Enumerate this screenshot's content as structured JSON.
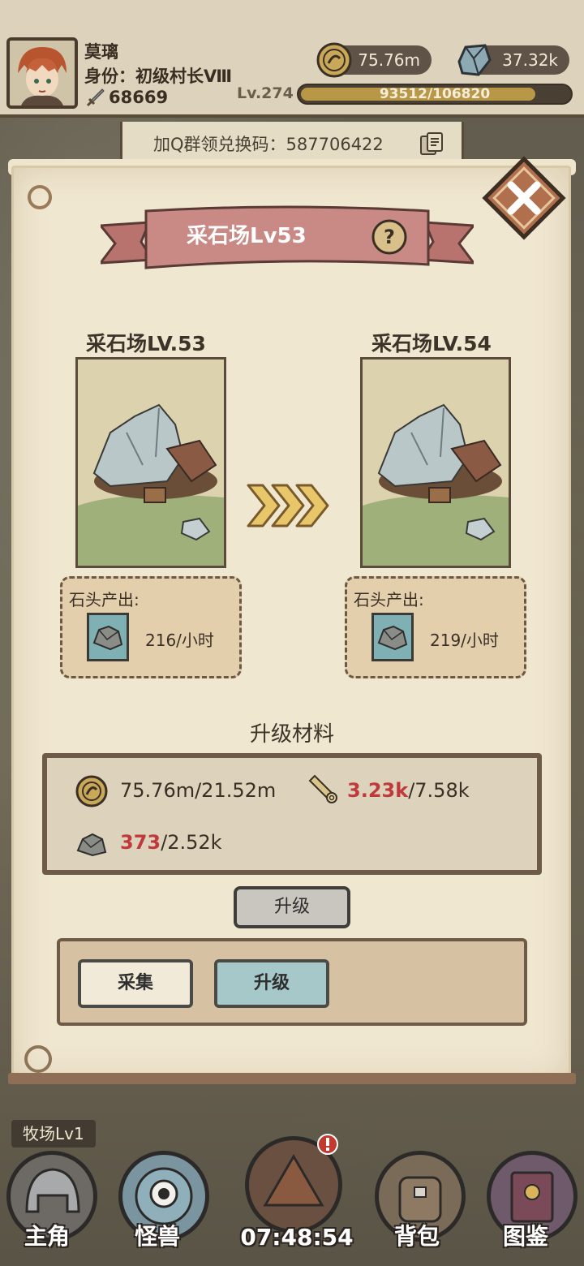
{
  "player": {
    "name": "莫璃",
    "rank": "身份：初级村长Ⅷ",
    "power": "68669",
    "level": "Lv.274",
    "xp_text": "93512/106820",
    "xp_progress": 0.875
  },
  "resources": {
    "gold": "75.76m",
    "stone": "37.32k"
  },
  "redeem": {
    "text": "加Q群领兑换码：587706422"
  },
  "dialog": {
    "title": "采石场Lv53",
    "current_level_label": "采石场LV.53",
    "next_level_label": "采石场LV.54",
    "current_output_label": "石头产出:",
    "next_output_label": "石头产出:",
    "current_output_value": "216/小时",
    "next_output_value": "219/小时",
    "materials_title": "升级材料",
    "materials": {
      "gold_have": "75.76m",
      "gold_need": "/21.52m",
      "wood_have": "3.23k",
      "wood_need": "/7.58k",
      "stone_have": "373",
      "stone_need": "/2.52k"
    },
    "upgrade_button": "升级",
    "tabs": {
      "collect": "采集",
      "upgrade": "升级"
    }
  },
  "bottom": {
    "farm_label": "牧场Lv1",
    "nav": {
      "hero": "主角",
      "monster": "怪兽",
      "bag": "背包",
      "codex": "图鉴"
    },
    "timer": "07:48:54"
  },
  "colors": {
    "panel": "#f0e7d1",
    "banner": "#c98a86",
    "accent_red": "#c0393c",
    "xp_fill": "#b89746",
    "upgrade_tab": "#a7c8c9"
  },
  "icons": [
    "sword-icon",
    "gold-coin-icon",
    "stone-ore-icon",
    "copy-icon",
    "close-icon",
    "help-icon",
    "arrow-right-icon",
    "wood-log-icon",
    "alert-icon"
  ]
}
